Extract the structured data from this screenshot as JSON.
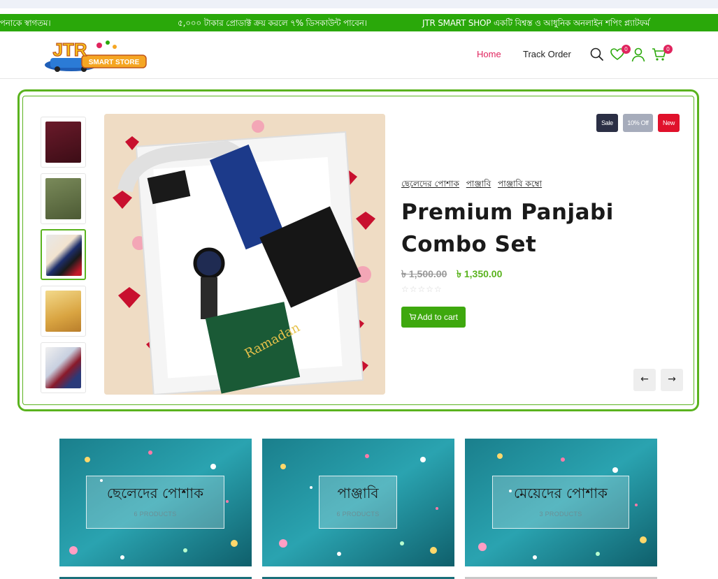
{
  "marquee": {
    "items": [
      "আপনাকে স্বাগতম।",
      "৫,০০০ টাকার প্রোডাক্ট ক্রয় করলে ৭% ডিসকাউন্ট পাবেন।",
      "JTR SMART SHOP একটি বিশ্বস্ত ও আধুনিক অনলাইন শপিং প্ল্যাটফর্ম"
    ]
  },
  "header": {
    "logo_text_top": "JTR",
    "logo_text_bottom": "SMART STORE",
    "nav": {
      "home": "Home",
      "track_order": "Track Order"
    },
    "wishlist_count": "0",
    "cart_count": "0"
  },
  "hero": {
    "tags": {
      "sale": "Sale",
      "discount": "10% Off",
      "new": "New"
    },
    "categories": [
      "ছেলেদের পোশাক",
      "পাঞ্জাবি",
      "পাঞ্জাবি কম্বো"
    ],
    "title": "Premium Panjabi Combo Set",
    "old_price": "৳ 1,500.00",
    "new_price": "৳ 1,350.00",
    "rating_stars": "☆☆☆☆☆",
    "add_to_cart": "Add to cart",
    "active_thumb": 3
  },
  "categories": [
    {
      "name": "ছেলেদের পোশাক",
      "count": "6 PRODUCTS"
    },
    {
      "name": "পাঞ্জাবি",
      "count": "6 PRODUCTS"
    },
    {
      "name": "মেয়েদের পোশাক",
      "count": "3 PRODUCTS"
    }
  ],
  "colors": {
    "accent_green": "#5ab31e",
    "marquee_green": "#2aa80a",
    "brand_pink": "#e0245e"
  }
}
